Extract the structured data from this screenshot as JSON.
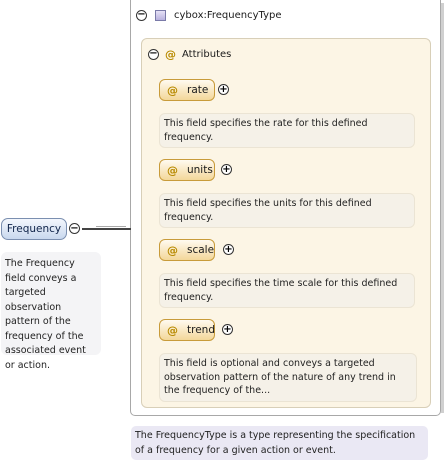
{
  "element": {
    "name": "Frequency",
    "description": "The Frequency field conveys a targeted observation pattern of the frequency of the associated event or action."
  },
  "type": {
    "name": "cybox:FrequencyType",
    "description": "The FrequencyType is a type representing the specification of a frequency for a given action or event."
  },
  "attributes_group": {
    "label": "Attributes"
  },
  "attributes": [
    {
      "name": "rate",
      "description": "This field specifies the rate for this defined frequency."
    },
    {
      "name": "units",
      "description": "This field specifies the units for this defined frequency."
    },
    {
      "name": "scale",
      "description": "This field specifies the time scale for this defined frequency."
    },
    {
      "name": "trend",
      "description": "This field is optional and conveys a targeted observation pattern of the nature of any trend in the frequency of the..."
    }
  ],
  "symbols": {
    "collapse": "⊖",
    "expand": "+",
    "attribute_marker": "@"
  }
}
